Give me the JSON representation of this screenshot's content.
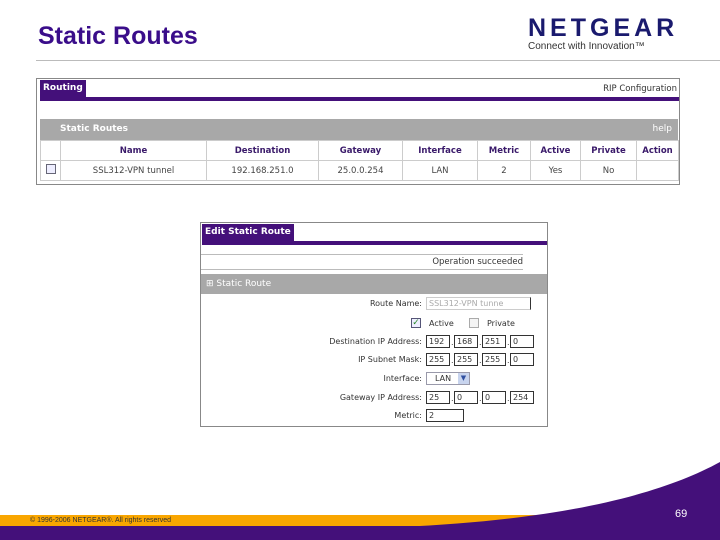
{
  "slide": {
    "title": "Static Routes",
    "logo_brand": "NETGEAR",
    "logo_tagline": "Connect with Innovation™",
    "copyright": "© 1996-2006 NETGEAR®. All rights reserved",
    "page_number": "69",
    "colors": {
      "purple": "#44107a",
      "orange": "#f9a600"
    }
  },
  "routing": {
    "tab": "Routing",
    "rip_link": "RIP Configuration",
    "section": "Static Routes",
    "help": "help",
    "columns": [
      "Name",
      "Destination",
      "Gateway",
      "Interface",
      "Metric",
      "Active",
      "Private",
      "Action"
    ],
    "rows": [
      {
        "name": "SSL312-VPN tunnel",
        "destination": "192.168.251.0",
        "gateway": "25.0.0.254",
        "interface": "LAN",
        "metric": "2",
        "active": "Yes",
        "private": "No",
        "action": ""
      }
    ]
  },
  "edit": {
    "tab": "Edit Static Route",
    "status": "Operation succeeded",
    "section": "Static Route",
    "route_name_label": "Route Name:",
    "route_name": "SSL312-VPN tunne",
    "active_label": "Active",
    "active_checked": true,
    "private_label": "Private",
    "private_checked": false,
    "dest_label": "Destination IP Address:",
    "dest": [
      "192",
      "168",
      "251",
      "0"
    ],
    "mask_label": "IP Subnet Mask:",
    "mask": [
      "255",
      "255",
      "255",
      "0"
    ],
    "interface_label": "Interface:",
    "interface": "LAN",
    "gateway_label": "Gateway IP Address:",
    "gateway": [
      "25",
      "0",
      "0",
      "254"
    ],
    "metric_label": "Metric:",
    "metric": "2"
  }
}
